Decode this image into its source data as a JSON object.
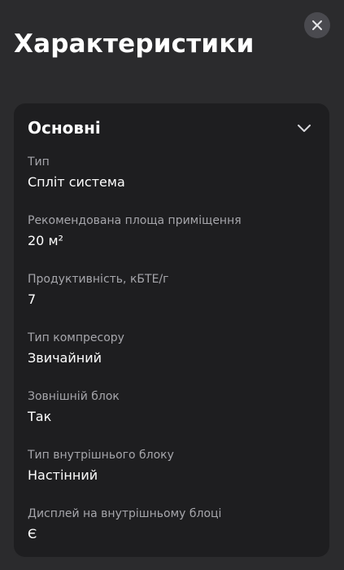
{
  "header": {
    "title": "Характеристики",
    "close_icon": "close-icon"
  },
  "section": {
    "title": "Основні",
    "expand_icon": "chevron-down-icon",
    "items": [
      {
        "label": "Тип",
        "value": "Спліт система"
      },
      {
        "label": "Рекомендована площа приміщення",
        "value": "20 м²"
      },
      {
        "label": "Продуктивність, кБТЕ/г",
        "value": "7"
      },
      {
        "label": "Тип компресору",
        "value": "Звичайний"
      },
      {
        "label": "Зовнішній блок",
        "value": "Так"
      },
      {
        "label": "Тип внутрішнього блоку",
        "value": "Настінний"
      },
      {
        "label": "Дисплей на внутрішньому блоці",
        "value": "Є"
      }
    ]
  },
  "colors": {
    "background": "#2b2b2d",
    "card": "#1e1e20",
    "label": "#a6a6ab",
    "text": "#ffffff",
    "close_button_bg": "#4a4a4f"
  }
}
